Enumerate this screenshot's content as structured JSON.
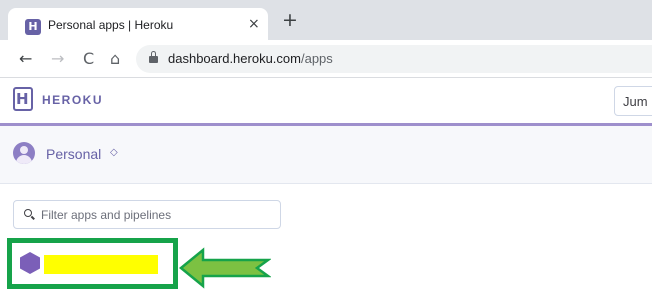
{
  "browser": {
    "tab_title": "Personal apps | Heroku",
    "tab_favicon_letter": "H",
    "close_glyph": "×",
    "new_tab_glyph": "+",
    "back_glyph": "←",
    "forward_glyph": "→",
    "reload_glyph": "C",
    "home_glyph": "⌂",
    "url_host": "dashboard.heroku.com",
    "url_path": "/apps"
  },
  "header": {
    "logo_letter": "H",
    "wordmark": "HEROKU",
    "jump_text": "Jum"
  },
  "account": {
    "label": "Personal",
    "caret": "◇"
  },
  "filter": {
    "placeholder": "Filter apps and pipelines"
  },
  "app_list": {
    "highlight_color": "#16a34a",
    "redaction_color": "#ffff00",
    "app_icon_color": "#7b5fb8"
  },
  "colors": {
    "heroku_purple": "#6762a6",
    "accent_rule": "#9e8fcc",
    "arrow_fill": "#7cc142",
    "arrow_stroke": "#16a34a"
  }
}
